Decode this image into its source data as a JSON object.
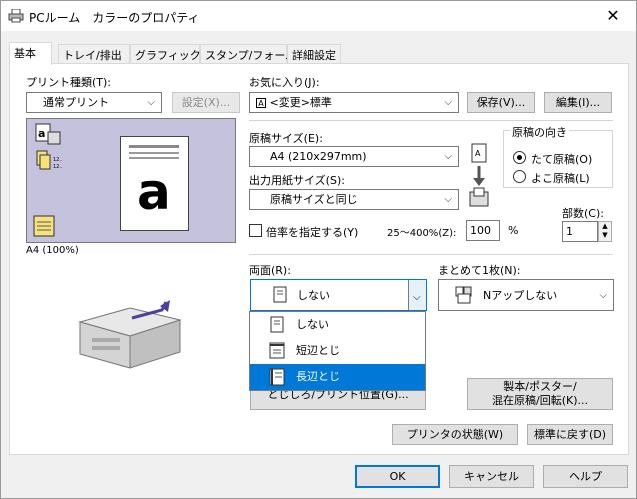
{
  "window": {
    "title": "PCルーム　カラーのプロパティ",
    "close_label": "✕"
  },
  "tabs": [
    {
      "label": "基本"
    },
    {
      "label": "トレイ/排出"
    },
    {
      "label": "グラフィックス"
    },
    {
      "label": "スタンプ/フォーム"
    },
    {
      "label": "詳細設定"
    }
  ],
  "print_type": {
    "label": "プリント種類(T):",
    "value": "通常プリント",
    "settings_button": "設定(X)..."
  },
  "preview": {
    "caption": "A4 (100%)",
    "letter": "a"
  },
  "favorites": {
    "label": "お気に入り(J):",
    "value": "<変更>標準",
    "save_button": "保存(V)...",
    "edit_button": "編集(I)..."
  },
  "original_size": {
    "label": "原稿サイズ(E):",
    "value": "A4 (210x297mm)"
  },
  "output_size": {
    "label": "出力用紙サイズ(S):",
    "value": "原稿サイズと同じ"
  },
  "orientation": {
    "label": "原稿の向き",
    "options": [
      "たて原稿(O)",
      "よこ原稿(L)"
    ],
    "selected": 0
  },
  "scale": {
    "checkbox_label": "倍率を指定する(Y)",
    "range_label": "25〜400%(Z):",
    "value": "100",
    "unit": "%"
  },
  "copies": {
    "label": "部数(C):",
    "value": "1"
  },
  "duplex": {
    "label": "両面(R):",
    "value": "しない",
    "options": [
      {
        "label": "しない"
      },
      {
        "label": "短辺とじ"
      },
      {
        "label": "長辺とじ"
      }
    ],
    "highlighted": 2
  },
  "nup": {
    "label": "まとめて1枚(N):",
    "value": "Nアップしない"
  },
  "binding_button": "とじしろ/プリント位置(G)...",
  "booklet_button": {
    "line1": "製本/ポスター/",
    "line2": "混在原稿/回転(K)..."
  },
  "status_button": "プリンタの状態(W)",
  "restore_button": "標準に戻す(D)",
  "footer": {
    "ok": "OK",
    "cancel": "キャンセル",
    "help": "ヘルプ"
  }
}
